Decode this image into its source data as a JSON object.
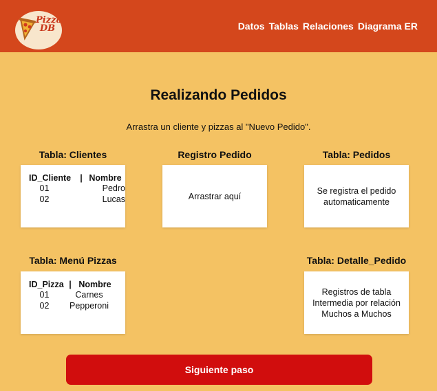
{
  "header": {
    "logo_text_line1": "Pizza",
    "logo_text_line2": "DB",
    "nav": [
      "Datos",
      "Tablas",
      "Relaciones",
      "Diagrama ER"
    ]
  },
  "main": {
    "title": "Realizando Pedidos",
    "subtitle": "Arrastra un cliente y pizzas al \"Nuevo Pedido\"."
  },
  "clientes": {
    "title": "Tabla: Clientes",
    "headers": [
      "ID_Cliente",
      "Nombre"
    ],
    "rows": [
      [
        "01",
        "Pedro"
      ],
      [
        "02",
        "Lucas"
      ]
    ]
  },
  "registro": {
    "title": "Registro Pedido",
    "drop_text": "Arrastrar aquí"
  },
  "pedidos": {
    "title": "Tabla: Pedidos",
    "text_line1": "Se registra el pedido",
    "text_line2": "automaticamente"
  },
  "menu": {
    "title": "Tabla: Menú Pizzas",
    "headers": [
      "ID_Pizza",
      "Nombre"
    ],
    "rows": [
      [
        "01",
        "Carnes"
      ],
      [
        "02",
        "Pepperoni"
      ]
    ]
  },
  "detalle": {
    "title": "Tabla: Detalle_Pedido",
    "text_line1": "Registros de tabla",
    "text_line2": "Intermedia por relación",
    "text_line3": "Muchos a Muchos"
  },
  "button": {
    "label": "Siguiente paso"
  },
  "colors": {
    "header": "#D4471C",
    "background": "#F4C263",
    "button": "#D10D0D"
  }
}
